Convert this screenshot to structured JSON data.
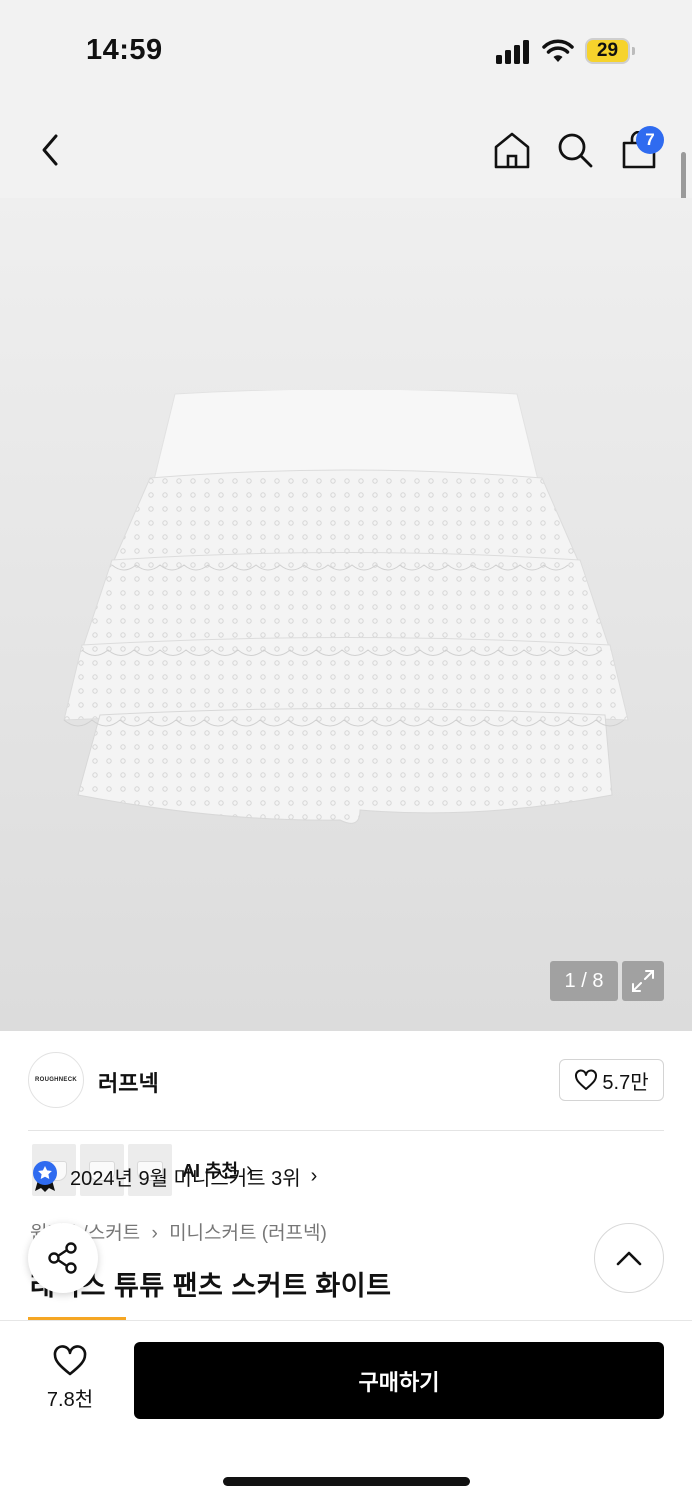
{
  "status_bar": {
    "time": "14:59",
    "battery_level": "29",
    "icons": [
      "cellular-signal-icon",
      "wifi-icon",
      "battery-icon"
    ]
  },
  "nav": {
    "icons": [
      "back-arrow-icon",
      "home-icon",
      "search-icon",
      "shopping-bag-icon"
    ],
    "cart_count": "7"
  },
  "gallery": {
    "ai_recommend_label": "AI 추천",
    "page_indicator": "1 / 8",
    "thumbnail_count": 3
  },
  "brand": {
    "logo_text": "ROUGHNECK",
    "name": "러프넥",
    "likes": "5.7만"
  },
  "ranking": {
    "text": "2024년 9월 미니스커트 3위"
  },
  "breadcrumb": {
    "category": "원피스/스커트",
    "subcategory": "미니스커트 (러프넥)"
  },
  "product": {
    "title": "레이스 튜튜 팬츠 스커트 화이트"
  },
  "bottom_bar": {
    "wish_count": "7.8천",
    "buy_label": "구매하기"
  },
  "colors": {
    "accent_blue": "#2f6bf0",
    "battery_yellow": "#f6d32c",
    "tab_orange": "#f5a623",
    "buy_button": "#000000"
  }
}
